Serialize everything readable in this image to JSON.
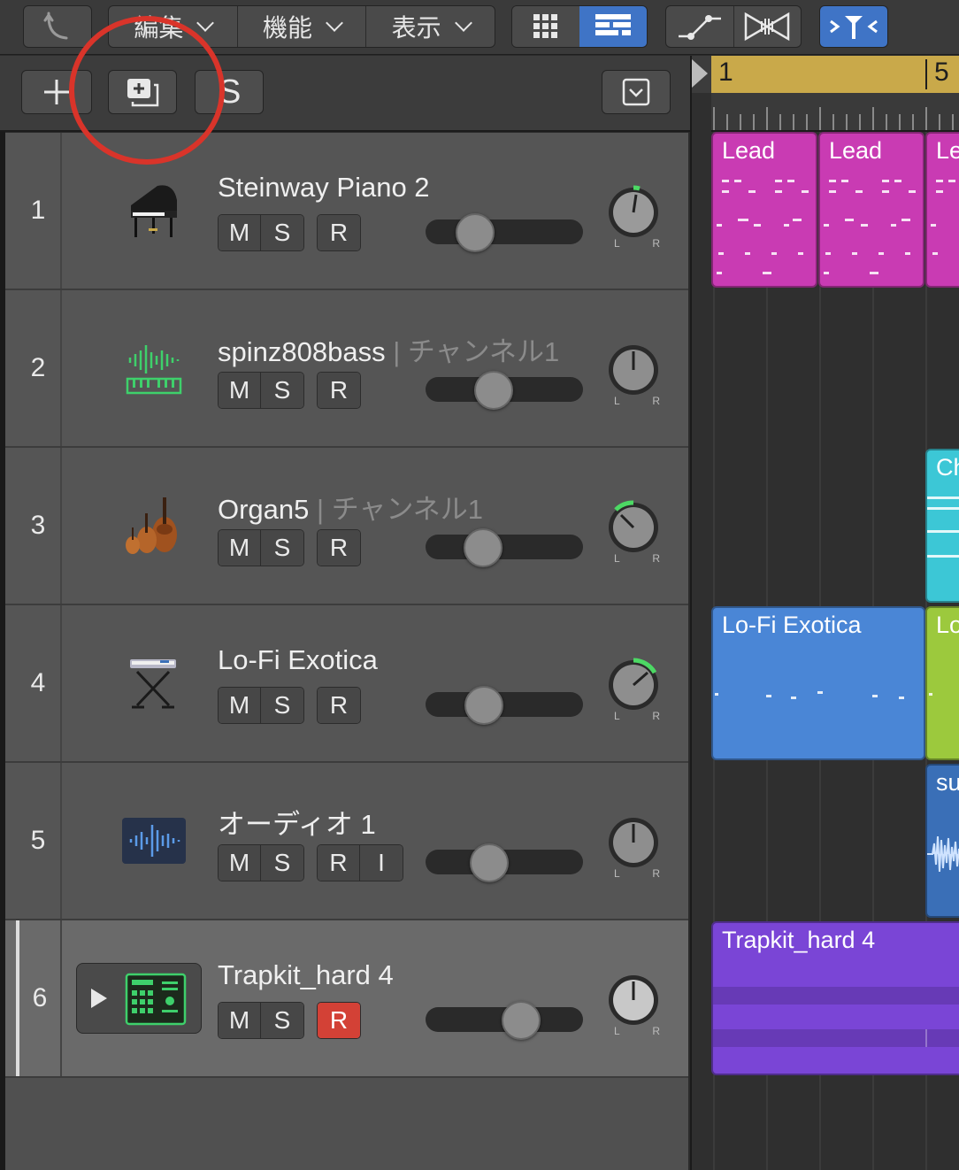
{
  "toolbar": {
    "menus": [
      {
        "label": "編集"
      },
      {
        "label": "機能"
      },
      {
        "label": "表示"
      }
    ]
  },
  "track_header": {
    "partial_label": "S"
  },
  "ruler": {
    "bar_1": "1",
    "bar_5": "5"
  },
  "tracks": [
    {
      "number": "1",
      "name": "Steinway Piano 2",
      "sub": "",
      "icon": "grand-piano-icon",
      "buttons": [
        "M",
        "S",
        "R"
      ],
      "fader": 0.25,
      "pan_color": "#4cd964"
    },
    {
      "number": "2",
      "name": "spinz808bass",
      "sub": "| チャンネル1",
      "icon": "synth-waveform-icon",
      "buttons": [
        "M",
        "S",
        "R"
      ],
      "fader": 0.41,
      "pan_color": "#666666"
    },
    {
      "number": "3",
      "name": "Organ5",
      "sub": "| チャンネル1",
      "icon": "strings-ensemble-icon",
      "buttons": [
        "M",
        "S",
        "R"
      ],
      "fader": 0.32,
      "pan_color": "#4cd964"
    },
    {
      "number": "4",
      "name": "Lo-Fi Exotica",
      "sub": "",
      "icon": "keyboard-stand-icon",
      "buttons": [
        "M",
        "S",
        "R"
      ],
      "fader": 0.33,
      "pan_color": "#4cd964"
    },
    {
      "number": "5",
      "name": "オーディオ 1",
      "sub": "",
      "icon": "audio-waveform-icon",
      "buttons": [
        "M",
        "S",
        "R",
        "I"
      ],
      "fader": 0.37,
      "pan_color": "#666666"
    },
    {
      "number": "6",
      "name": "Trapkit_hard 4",
      "sub": "",
      "icon": "drum-machine-icon",
      "buttons": [
        "M",
        "S",
        "R"
      ],
      "fader": 0.64,
      "pan_color": "#666666",
      "selected": true,
      "record_armed": true
    }
  ],
  "regions": [
    {
      "label": "Lead",
      "color": "#c93bb3"
    },
    {
      "label": "Lead",
      "color": "#c93bb3"
    },
    {
      "label": "Le",
      "color": "#c93bb3"
    },
    {
      "label": "Ch",
      "color": "#3cc7d6"
    },
    {
      "label": "Lo-Fi Exotica",
      "color": "#4a86d6"
    },
    {
      "label": "Lo",
      "color": "#9cc93d"
    },
    {
      "label": "su",
      "color": "#3a6fb7"
    },
    {
      "label": "Trapkit_hard 4",
      "color": "#7a45d6"
    }
  ]
}
